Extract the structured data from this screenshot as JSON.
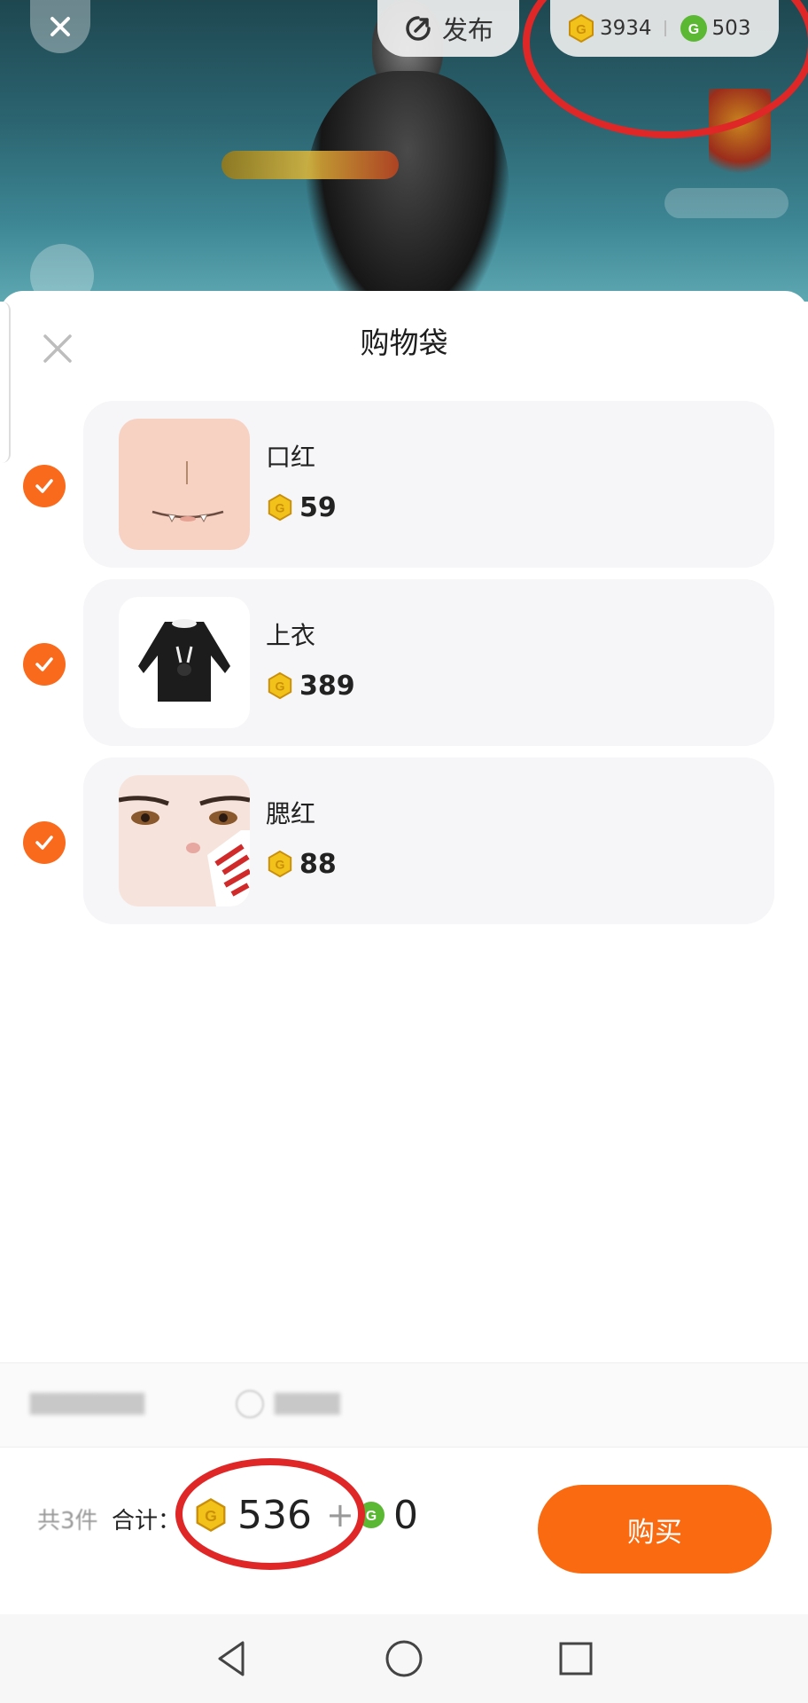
{
  "header": {
    "publish_label": "发布",
    "gold_balance": "3934",
    "green_balance": "503"
  },
  "sheet": {
    "title": "购物袋",
    "items": [
      {
        "name": "口红",
        "price": "59",
        "checked": true
      },
      {
        "name": "上衣",
        "price": "389",
        "checked": true
      },
      {
        "name": "腮红",
        "price": "88",
        "checked": true
      }
    ]
  },
  "footer": {
    "count_label": "共3件",
    "total_label": "合计：",
    "gold_total": "536",
    "plus": "+",
    "green_total": "0",
    "buy_label": "购买"
  },
  "colors": {
    "accent": "#fa6a10",
    "gold_coin": "#f2c21a",
    "green_coin": "#5ab833",
    "annotation": "#e02727"
  },
  "icons": [
    "close-icon",
    "publish-icon",
    "gold-coin-icon",
    "green-coin-icon",
    "checkmark-icon",
    "back-nav-icon",
    "home-nav-icon",
    "recents-nav-icon"
  ]
}
